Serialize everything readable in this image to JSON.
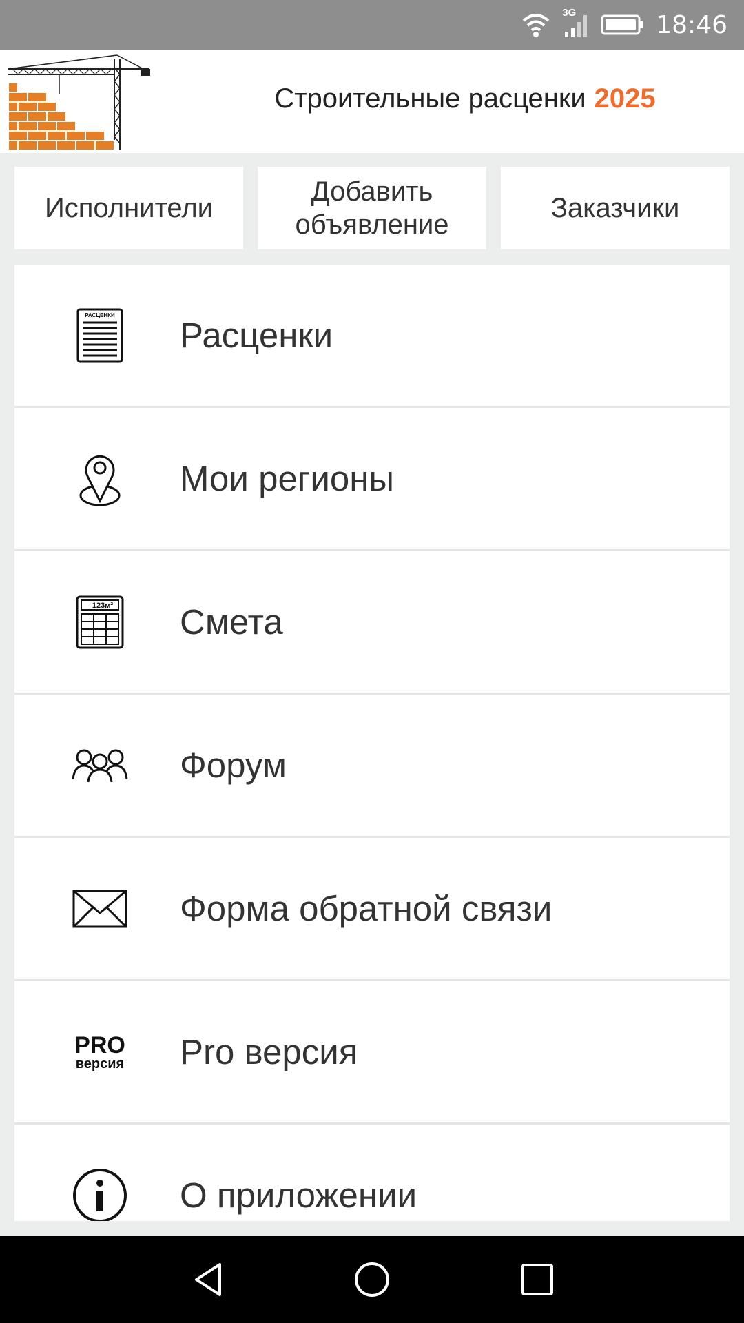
{
  "status_bar": {
    "time": "18:46",
    "network": "3G",
    "icons": [
      "wifi-icon",
      "signal-icon",
      "battery-icon"
    ]
  },
  "header": {
    "title": "Строительные расценки",
    "year": "2025",
    "accent_color": "#EE6C2E"
  },
  "top_buttons": {
    "performers": "Исполнители",
    "add_ad_line1": "Добавить",
    "add_ad_line2": "объявление",
    "customers": "Заказчики"
  },
  "menu": {
    "items": [
      {
        "label": "Расценки",
        "icon": "price-list-icon",
        "icon_text": "РАСЦЕНКИ"
      },
      {
        "label": "Мои регионы",
        "icon": "location-pin-icon"
      },
      {
        "label": "Смета",
        "icon": "estimate-calculator-icon",
        "icon_text": "123м²"
      },
      {
        "label": "Форум",
        "icon": "people-icon"
      },
      {
        "label": "Форма обратной связи",
        "icon": "envelope-icon"
      },
      {
        "label": "Pro версия",
        "icon": "pro-icon",
        "icon_text": "PRO",
        "icon_subtext": "версия"
      },
      {
        "label": "О приложении",
        "icon": "info-icon"
      }
    ]
  },
  "nav_bar": {
    "buttons": [
      "back-icon",
      "home-icon",
      "recents-icon"
    ]
  }
}
